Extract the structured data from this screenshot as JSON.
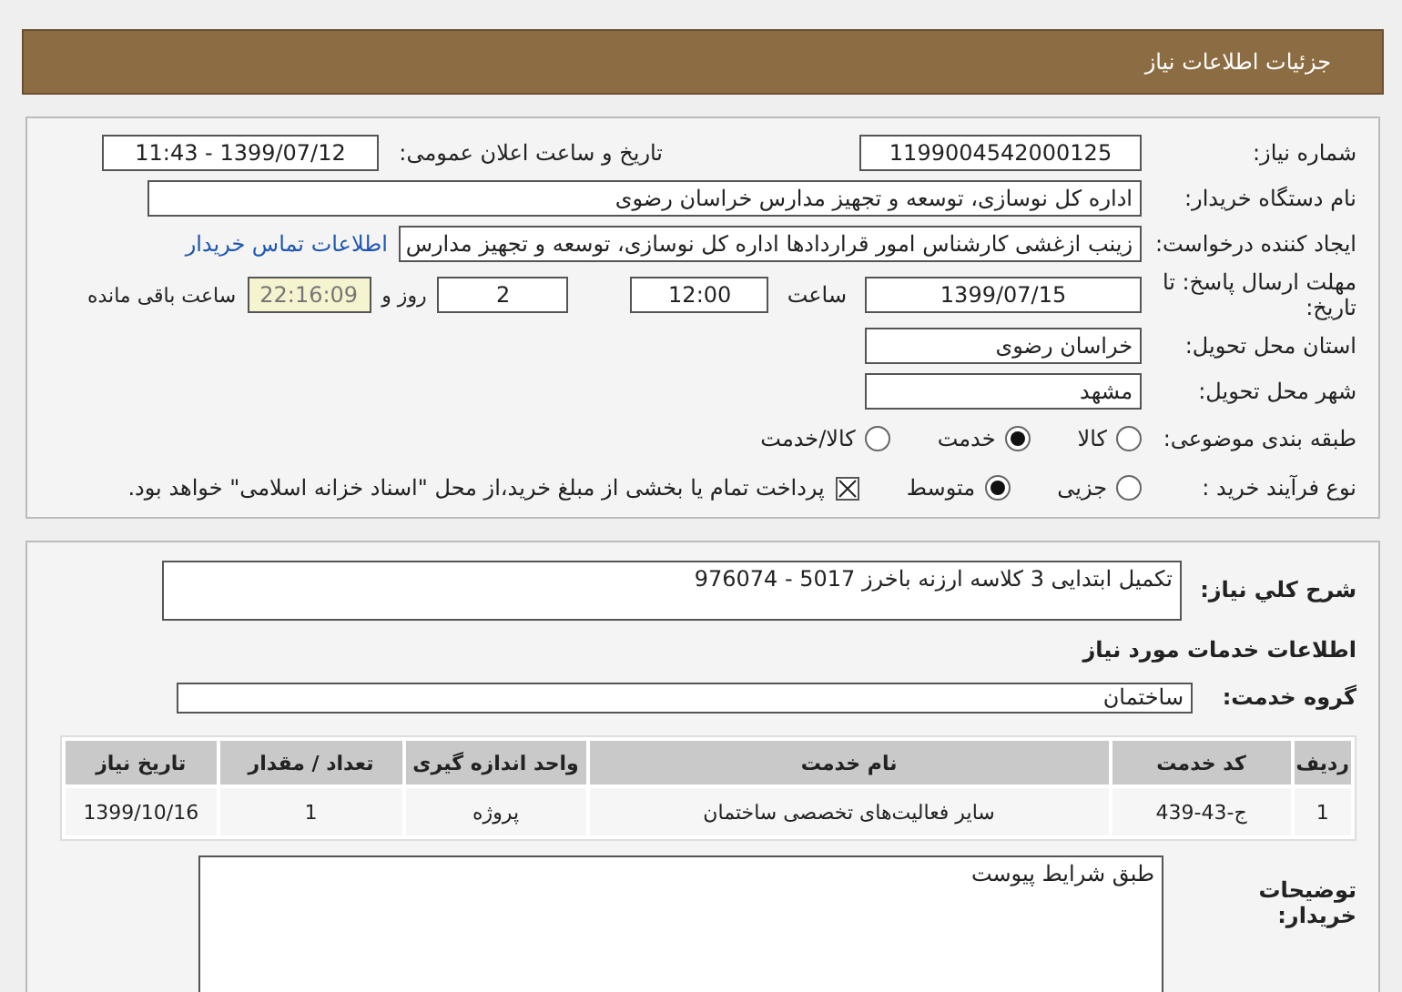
{
  "header": {
    "title": "جزئیات اطلاعات نیاز"
  },
  "info": {
    "need_number": {
      "label": "شماره نیاز:",
      "value": "1199004542000125"
    },
    "announce": {
      "label": "تاریخ و ساعت اعلان عمومی:",
      "value": "1399/07/12 - 11:43"
    },
    "buyer_org": {
      "label": "نام دستگاه خریدار:",
      "value": "اداره کل نوسازی، توسعه و تجهیز مدارس خراسان رضوی"
    },
    "requester": {
      "label": "ایجاد کننده درخواست:",
      "value": "زینب ازغشی کارشناس امور قراردادها اداره کل نوسازی، توسعه و تجهیز مدارس",
      "link": "اطلاعات تماس خریدار"
    },
    "deadline": {
      "label": "مهلت ارسال پاسخ: تا تاریخ:",
      "date": "1399/07/15",
      "time_label": "ساعت",
      "time": "12:00",
      "days": "2",
      "days_label": "روز و",
      "remaining": "22:16:09",
      "remaining_label": "ساعت باقی مانده"
    },
    "province": {
      "label": "استان محل تحویل:",
      "value": "خراسان رضوی"
    },
    "city": {
      "label": "شهر محل تحویل:",
      "value": "مشهد"
    },
    "category": {
      "label": "طبقه بندی موضوعی:",
      "options": [
        {
          "label": "کالا",
          "selected": false
        },
        {
          "label": "خدمت",
          "selected": true
        },
        {
          "label": "کالا/خدمت",
          "selected": false
        }
      ]
    },
    "purchase_type": {
      "label": "نوع فرآیند خرید :",
      "options": [
        {
          "label": "جزیی",
          "selected": false
        },
        {
          "label": "متوسط",
          "selected": true
        }
      ],
      "treasury": {
        "checked": true,
        "label": "پرداخت تمام یا بخشی از مبلغ خرید،از محل \"اسناد خزانه اسلامی\" خواهد بود."
      }
    }
  },
  "detail": {
    "description": {
      "label": "شرح کلي نياز:",
      "value": "تکمیل ابتدایی 3 کلاسه ارزنه باخرز 5017 - 976074"
    },
    "services_heading": "اطلاعات خدمات مورد نیاز",
    "service_group": {
      "label": "گروه خدمت:",
      "value": "ساختمان"
    },
    "table": {
      "columns": [
        "ردیف",
        "کد خدمت",
        "نام خدمت",
        "واحد اندازه گیری",
        "تعداد / مقدار",
        "تاریخ نیاز"
      ],
      "rows": [
        [
          "1",
          "ج-43-439",
          "سایر فعالیت‌های تخصصی ساختمان",
          "پروژه",
          "1",
          "1399/10/16"
        ]
      ]
    },
    "buyer_notes": {
      "label": "توضیحات خریدار:",
      "value": "طبق شرایط پیوست"
    }
  }
}
